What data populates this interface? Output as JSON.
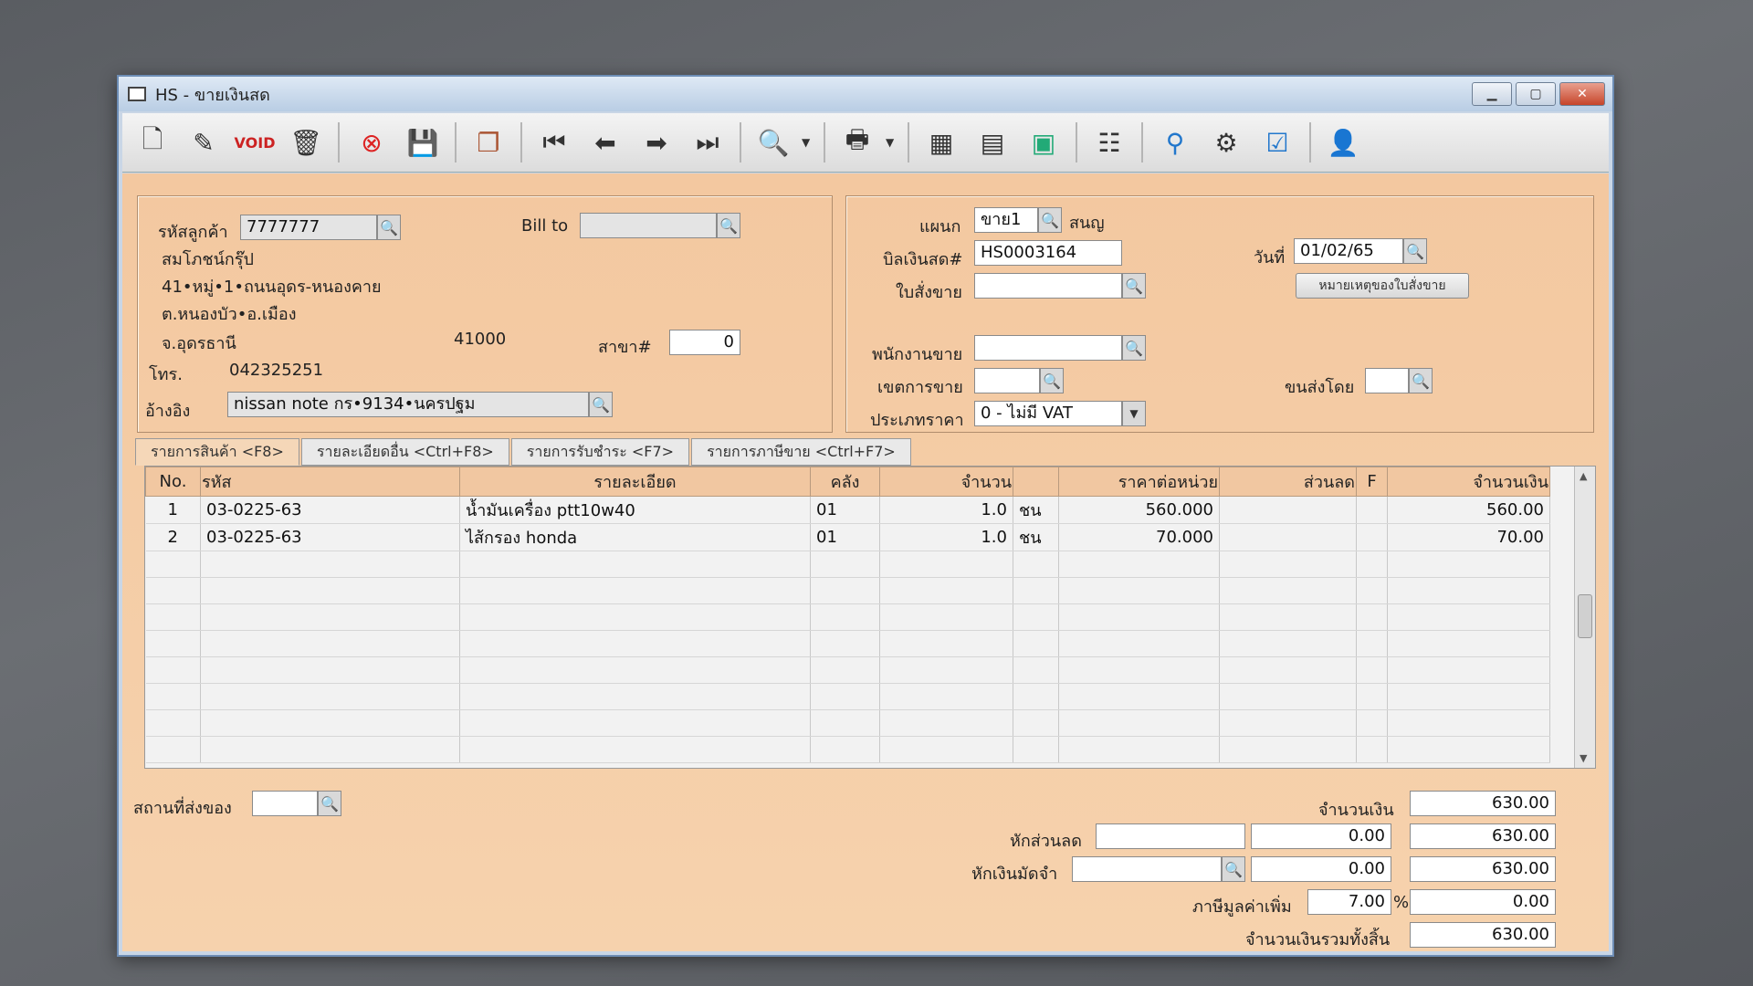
{
  "window": {
    "title": "HS - ขายเงินสด"
  },
  "toolbar": {
    "icons": [
      "new-doc-icon",
      "edit-icon",
      "void-icon",
      "trash-icon",
      "cancel-icon",
      "save-icon",
      "copy-icon",
      "first-record-icon",
      "prev-record-icon",
      "next-record-icon",
      "last-record-icon",
      "search-doc-icon",
      "print-icon",
      "calc-icon",
      "tax-icon",
      "calendar-icon",
      "report-icon",
      "approve-icon",
      "tools-icon",
      "ok-icon",
      "user-icon"
    ]
  },
  "customer": {
    "code_label": "รหัสลูกค้า",
    "code_value": "7777777",
    "bill_to_label": "Bill to",
    "bill_to_value": "",
    "name": "สมโภชน์กรุ๊ป",
    "address1": "41•หมู่•1•ถนนอุดร-หนองคาย",
    "address2": "ต.หนองบัว•อ.เมือง",
    "province": "จ.อุดรธานี",
    "postcode": "41000",
    "branch_label": "สาขา#",
    "branch_value": "0",
    "phone_label": "โทร.",
    "phone_value": "042325251",
    "ref_label": "อ้างอิง",
    "ref_value": "nissan note กร•9134•นครปฐม"
  },
  "doc": {
    "dept_label": "แผนก",
    "dept_value": "ขาย1",
    "dept_name": "สนญ",
    "bill_label": "บิลเงินสด#",
    "bill_value": "HS0003164",
    "order_label": "ใบสั่งขาย",
    "order_value": "",
    "date_label": "วันที่",
    "date_value": "01/02/65",
    "order_note_button": "หมายเหตุของใบสั่งขาย",
    "sales_label": "พนักงานขาย",
    "sales_value": "",
    "area_label": "เขตการขาย",
    "area_value": "",
    "ship_by_label": "ขนส่งโดย",
    "ship_by_value": "",
    "price_type_label": "ประเภทราคา",
    "price_type_value": "0 - ไม่มี VAT"
  },
  "tabs": [
    "รายการสินค้า <F8>",
    "รายละเอียดอื่น <Ctrl+F8>",
    "รายการรับชำระ <F7>",
    "รายการภาษีขาย <Ctrl+F7>"
  ],
  "grid": {
    "headers": [
      "No.",
      "รหัส",
      "รายละเอียด",
      "คลัง",
      "จำนวน",
      "",
      "ราคาต่อหน่วย",
      "ส่วนลด",
      "F",
      "จำนวนเงิน"
    ],
    "rows": [
      [
        "1",
        "03-0225-63",
        "น้ำมันเครื่อง ptt10w40",
        "01",
        "1.0",
        "ชน",
        "560.000",
        "",
        "",
        "560.00"
      ],
      [
        "2",
        "03-0225-63",
        "ไส้กรอง honda",
        "01",
        "1.0",
        "ชน",
        "70.000",
        "",
        "",
        "70.00"
      ]
    ]
  },
  "footer": {
    "ship_place_label": "สถานที่ส่งของ",
    "ship_place_value": "",
    "amount_label": "จำนวนเงิน",
    "amount_value": "630.00",
    "discount_label": "หักส่วนลด",
    "discount_input": "",
    "discount_value": "0.00",
    "discount_total": "630.00",
    "deposit_label": "หักเงินมัดจำ",
    "deposit_input": "",
    "deposit_value": "0.00",
    "deposit_total": "630.00",
    "vat_label": "ภาษีมูลค่าเพิ่ม",
    "vat_rate": "7.00",
    "vat_pct": "%",
    "vat_value": "0.00",
    "grand_label": "จำนวนเงินรวมทั้งสิ้น",
    "grand_value": "630.00"
  }
}
